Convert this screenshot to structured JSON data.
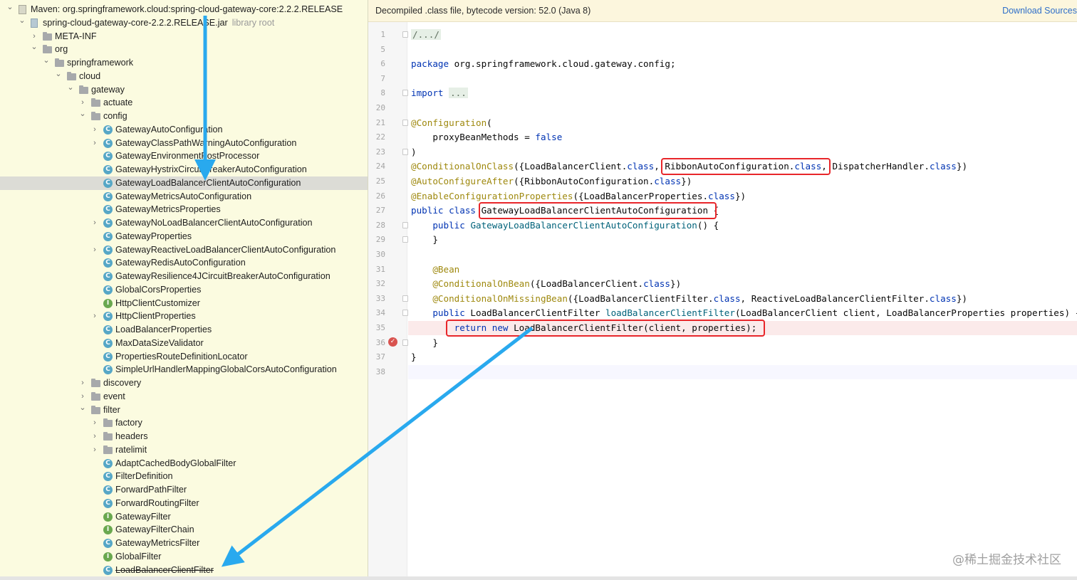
{
  "tree": [
    {
      "depth": 0,
      "expand": "open",
      "icon": "maven",
      "label": "Maven: org.springframework.cloud:spring-cloud-gateway-core:2.2.2.RELEASE",
      "suffix": ""
    },
    {
      "depth": 1,
      "expand": "open",
      "icon": "jar",
      "label": "spring-cloud-gateway-core-2.2.2.RELEASE.jar",
      "suffix": "library root"
    },
    {
      "depth": 2,
      "expand": "closed",
      "icon": "folder",
      "label": "META-INF",
      "suffix": ""
    },
    {
      "depth": 2,
      "expand": "open",
      "icon": "folder",
      "label": "org",
      "suffix": ""
    },
    {
      "depth": 3,
      "expand": "open",
      "icon": "folder",
      "label": "springframework",
      "suffix": ""
    },
    {
      "depth": 4,
      "expand": "open",
      "icon": "folder",
      "label": "cloud",
      "suffix": ""
    },
    {
      "depth": 5,
      "expand": "open",
      "icon": "folder",
      "label": "gateway",
      "suffix": ""
    },
    {
      "depth": 6,
      "expand": "closed",
      "icon": "folder",
      "label": "actuate",
      "suffix": ""
    },
    {
      "depth": 6,
      "expand": "open",
      "icon": "folder",
      "label": "config",
      "suffix": ""
    },
    {
      "depth": 7,
      "expand": "closed",
      "icon": "class",
      "label": "GatewayAutoConfiguration",
      "suffix": ""
    },
    {
      "depth": 7,
      "expand": "closed",
      "icon": "class",
      "label": "GatewayClassPathWarningAutoConfiguration",
      "suffix": ""
    },
    {
      "depth": 7,
      "expand": "none",
      "icon": "class",
      "label": "GatewayEnvironmentPostProcessor",
      "suffix": ""
    },
    {
      "depth": 7,
      "expand": "none",
      "icon": "class",
      "label": "GatewayHystrixCircuitBreakerAutoConfiguration",
      "suffix": ""
    },
    {
      "depth": 7,
      "expand": "none",
      "icon": "class",
      "label": "GatewayLoadBalancerClientAutoConfiguration",
      "suffix": "",
      "selected": true
    },
    {
      "depth": 7,
      "expand": "none",
      "icon": "class",
      "label": "GatewayMetricsAutoConfiguration",
      "suffix": ""
    },
    {
      "depth": 7,
      "expand": "none",
      "icon": "class",
      "label": "GatewayMetricsProperties",
      "suffix": ""
    },
    {
      "depth": 7,
      "expand": "closed",
      "icon": "class",
      "label": "GatewayNoLoadBalancerClientAutoConfiguration",
      "suffix": ""
    },
    {
      "depth": 7,
      "expand": "none",
      "icon": "class",
      "label": "GatewayProperties",
      "suffix": ""
    },
    {
      "depth": 7,
      "expand": "closed",
      "icon": "class",
      "label": "GatewayReactiveLoadBalancerClientAutoConfiguration",
      "suffix": ""
    },
    {
      "depth": 7,
      "expand": "none",
      "icon": "class",
      "label": "GatewayRedisAutoConfiguration",
      "suffix": ""
    },
    {
      "depth": 7,
      "expand": "none",
      "icon": "class",
      "label": "GatewayResilience4JCircuitBreakerAutoConfiguration",
      "suffix": ""
    },
    {
      "depth": 7,
      "expand": "none",
      "icon": "class",
      "label": "GlobalCorsProperties",
      "suffix": ""
    },
    {
      "depth": 7,
      "expand": "none",
      "icon": "interface",
      "label": "HttpClientCustomizer",
      "suffix": ""
    },
    {
      "depth": 7,
      "expand": "closed",
      "icon": "class",
      "label": "HttpClientProperties",
      "suffix": ""
    },
    {
      "depth": 7,
      "expand": "none",
      "icon": "class",
      "label": "LoadBalancerProperties",
      "suffix": ""
    },
    {
      "depth": 7,
      "expand": "none",
      "icon": "class",
      "label": "MaxDataSizeValidator",
      "suffix": ""
    },
    {
      "depth": 7,
      "expand": "none",
      "icon": "class",
      "label": "PropertiesRouteDefinitionLocator",
      "suffix": ""
    },
    {
      "depth": 7,
      "expand": "none",
      "icon": "class",
      "label": "SimpleUrlHandlerMappingGlobalCorsAutoConfiguration",
      "suffix": ""
    },
    {
      "depth": 6,
      "expand": "closed",
      "icon": "folder",
      "label": "discovery",
      "suffix": ""
    },
    {
      "depth": 6,
      "expand": "closed",
      "icon": "folder",
      "label": "event",
      "suffix": ""
    },
    {
      "depth": 6,
      "expand": "open",
      "icon": "folder",
      "label": "filter",
      "suffix": ""
    },
    {
      "depth": 7,
      "expand": "closed",
      "icon": "folder",
      "label": "factory",
      "suffix": ""
    },
    {
      "depth": 7,
      "expand": "closed",
      "icon": "folder",
      "label": "headers",
      "suffix": ""
    },
    {
      "depth": 7,
      "expand": "closed",
      "icon": "folder",
      "label": "ratelimit",
      "suffix": ""
    },
    {
      "depth": 7,
      "expand": "none",
      "icon": "class",
      "label": "AdaptCachedBodyGlobalFilter",
      "suffix": ""
    },
    {
      "depth": 7,
      "expand": "none",
      "icon": "class",
      "label": "FilterDefinition",
      "suffix": ""
    },
    {
      "depth": 7,
      "expand": "none",
      "icon": "class",
      "label": "ForwardPathFilter",
      "suffix": ""
    },
    {
      "depth": 7,
      "expand": "none",
      "icon": "class",
      "label": "ForwardRoutingFilter",
      "suffix": ""
    },
    {
      "depth": 7,
      "expand": "none",
      "icon": "interface",
      "label": "GatewayFilter",
      "suffix": ""
    },
    {
      "depth": 7,
      "expand": "none",
      "icon": "interface",
      "label": "GatewayFilterChain",
      "suffix": ""
    },
    {
      "depth": 7,
      "expand": "none",
      "icon": "class",
      "label": "GatewayMetricsFilter",
      "suffix": ""
    },
    {
      "depth": 7,
      "expand": "none",
      "icon": "interface",
      "label": "GlobalFilter",
      "suffix": ""
    },
    {
      "depth": 7,
      "expand": "none",
      "icon": "class",
      "label": "LoadBalancerClientFilter",
      "suffix": "",
      "strike": true
    }
  ],
  "editor": {
    "banner_text": "Decompiled .class file, bytecode version: 52.0 (Java 8)",
    "banner_link": "Download Sources",
    "breakpoint_line": "35",
    "lines": [
      {
        "num": "1",
        "fold": true,
        "segs": [
          [
            "/.../",
            "fold-chip"
          ]
        ]
      },
      {
        "num": "5",
        "fold": false,
        "segs": []
      },
      {
        "num": "6",
        "fold": false,
        "segs": [
          [
            "package",
            "kw"
          ],
          [
            " org.springframework.cloud.gateway.config;",
            ""
          ]
        ]
      },
      {
        "num": "7",
        "fold": false,
        "segs": []
      },
      {
        "num": "8",
        "fold": true,
        "segs": [
          [
            "import",
            "kw"
          ],
          [
            " ",
            ""
          ],
          [
            "...",
            "fold-chip"
          ]
        ]
      },
      {
        "num": "20",
        "fold": false,
        "segs": []
      },
      {
        "num": "21",
        "fold": true,
        "segs": [
          [
            "@Configuration",
            "an"
          ],
          [
            "(",
            ""
          ]
        ]
      },
      {
        "num": "22",
        "fold": false,
        "segs": [
          [
            "    proxyBeanMethods = ",
            ""
          ],
          [
            "false",
            "kw"
          ]
        ]
      },
      {
        "num": "23",
        "fold": true,
        "segs": [
          [
            ")",
            ""
          ]
        ]
      },
      {
        "num": "24",
        "fold": false,
        "segs": [
          [
            "@ConditionalOnClass",
            "an"
          ],
          [
            "({LoadBalancerClient.",
            ""
          ],
          [
            "class",
            "kw"
          ],
          [
            ", RibbonAutoConfiguration.",
            ""
          ],
          [
            "class",
            "kw"
          ],
          [
            ", DispatcherHandler.",
            ""
          ],
          [
            "class",
            "kw"
          ],
          [
            "})",
            ""
          ]
        ]
      },
      {
        "num": "25",
        "fold": false,
        "segs": [
          [
            "@AutoConfigureAfter",
            "an"
          ],
          [
            "({RibbonAutoConfiguration.",
            ""
          ],
          [
            "class",
            "kw"
          ],
          [
            "})",
            ""
          ]
        ]
      },
      {
        "num": "26",
        "fold": false,
        "segs": [
          [
            "@EnableConfigurationProperties",
            "an"
          ],
          [
            "({LoadBalancerProperties.",
            ""
          ],
          [
            "class",
            "kw"
          ],
          [
            "})",
            ""
          ]
        ]
      },
      {
        "num": "27",
        "fold": false,
        "segs": [
          [
            "public",
            "kw"
          ],
          [
            " ",
            ""
          ],
          [
            "class",
            "kw"
          ],
          [
            " GatewayLoadBalancerClientAutoConfiguration {",
            ""
          ]
        ]
      },
      {
        "num": "28",
        "fold": true,
        "segs": [
          [
            "    ",
            ""
          ],
          [
            "public",
            "kw"
          ],
          [
            " ",
            ""
          ],
          [
            "GatewayLoadBalancerClientAutoConfiguration",
            "fn"
          ],
          [
            "() {",
            ""
          ]
        ]
      },
      {
        "num": "29",
        "fold": true,
        "segs": [
          [
            "    }",
            ""
          ]
        ]
      },
      {
        "num": "30",
        "fold": false,
        "segs": []
      },
      {
        "num": "31",
        "fold": false,
        "segs": [
          [
            "    ",
            ""
          ],
          [
            "@Bean",
            "an"
          ]
        ]
      },
      {
        "num": "32",
        "fold": false,
        "segs": [
          [
            "    ",
            ""
          ],
          [
            "@ConditionalOnBean",
            "an"
          ],
          [
            "({LoadBalancerClient.",
            ""
          ],
          [
            "class",
            "kw"
          ],
          [
            "})",
            ""
          ]
        ]
      },
      {
        "num": "33",
        "fold": true,
        "segs": [
          [
            "    ",
            ""
          ],
          [
            "@ConditionalOnMissingBean",
            "an"
          ],
          [
            "({LoadBalancerClientFilter.",
            ""
          ],
          [
            "class",
            "kw"
          ],
          [
            ", ReactiveLoadBalancerClientFilter.",
            ""
          ],
          [
            "class",
            "kw"
          ],
          [
            "})",
            ""
          ]
        ]
      },
      {
        "num": "34",
        "fold": true,
        "segs": [
          [
            "    ",
            ""
          ],
          [
            "public",
            "kw"
          ],
          [
            " LoadBalancerClientFilter ",
            ""
          ],
          [
            "loadBalancerClientFilter",
            "fn"
          ],
          [
            "(LoadBalancerClient client, LoadBalancerProperties properties) {",
            ""
          ]
        ]
      },
      {
        "num": "35",
        "fold": false,
        "segs": [
          [
            "        ",
            ""
          ],
          [
            "return",
            "kw"
          ],
          [
            " ",
            ""
          ],
          [
            "new",
            "kw"
          ],
          [
            " LoadBalancerClientFilter(client, properties);",
            ""
          ]
        ]
      },
      {
        "num": "36",
        "fold": true,
        "segs": [
          [
            "    }",
            ""
          ]
        ]
      },
      {
        "num": "37",
        "fold": false,
        "segs": [
          [
            "}",
            ""
          ]
        ]
      },
      {
        "num": "38",
        "fold": false,
        "segs": []
      }
    ]
  },
  "watermark": "@稀土掘金技术社区",
  "colors": {
    "annotation_box": "#e8262a",
    "arrow": "#29a9ee",
    "selection": "#dcdcd6",
    "tree_bg": "#fbfbe0"
  }
}
